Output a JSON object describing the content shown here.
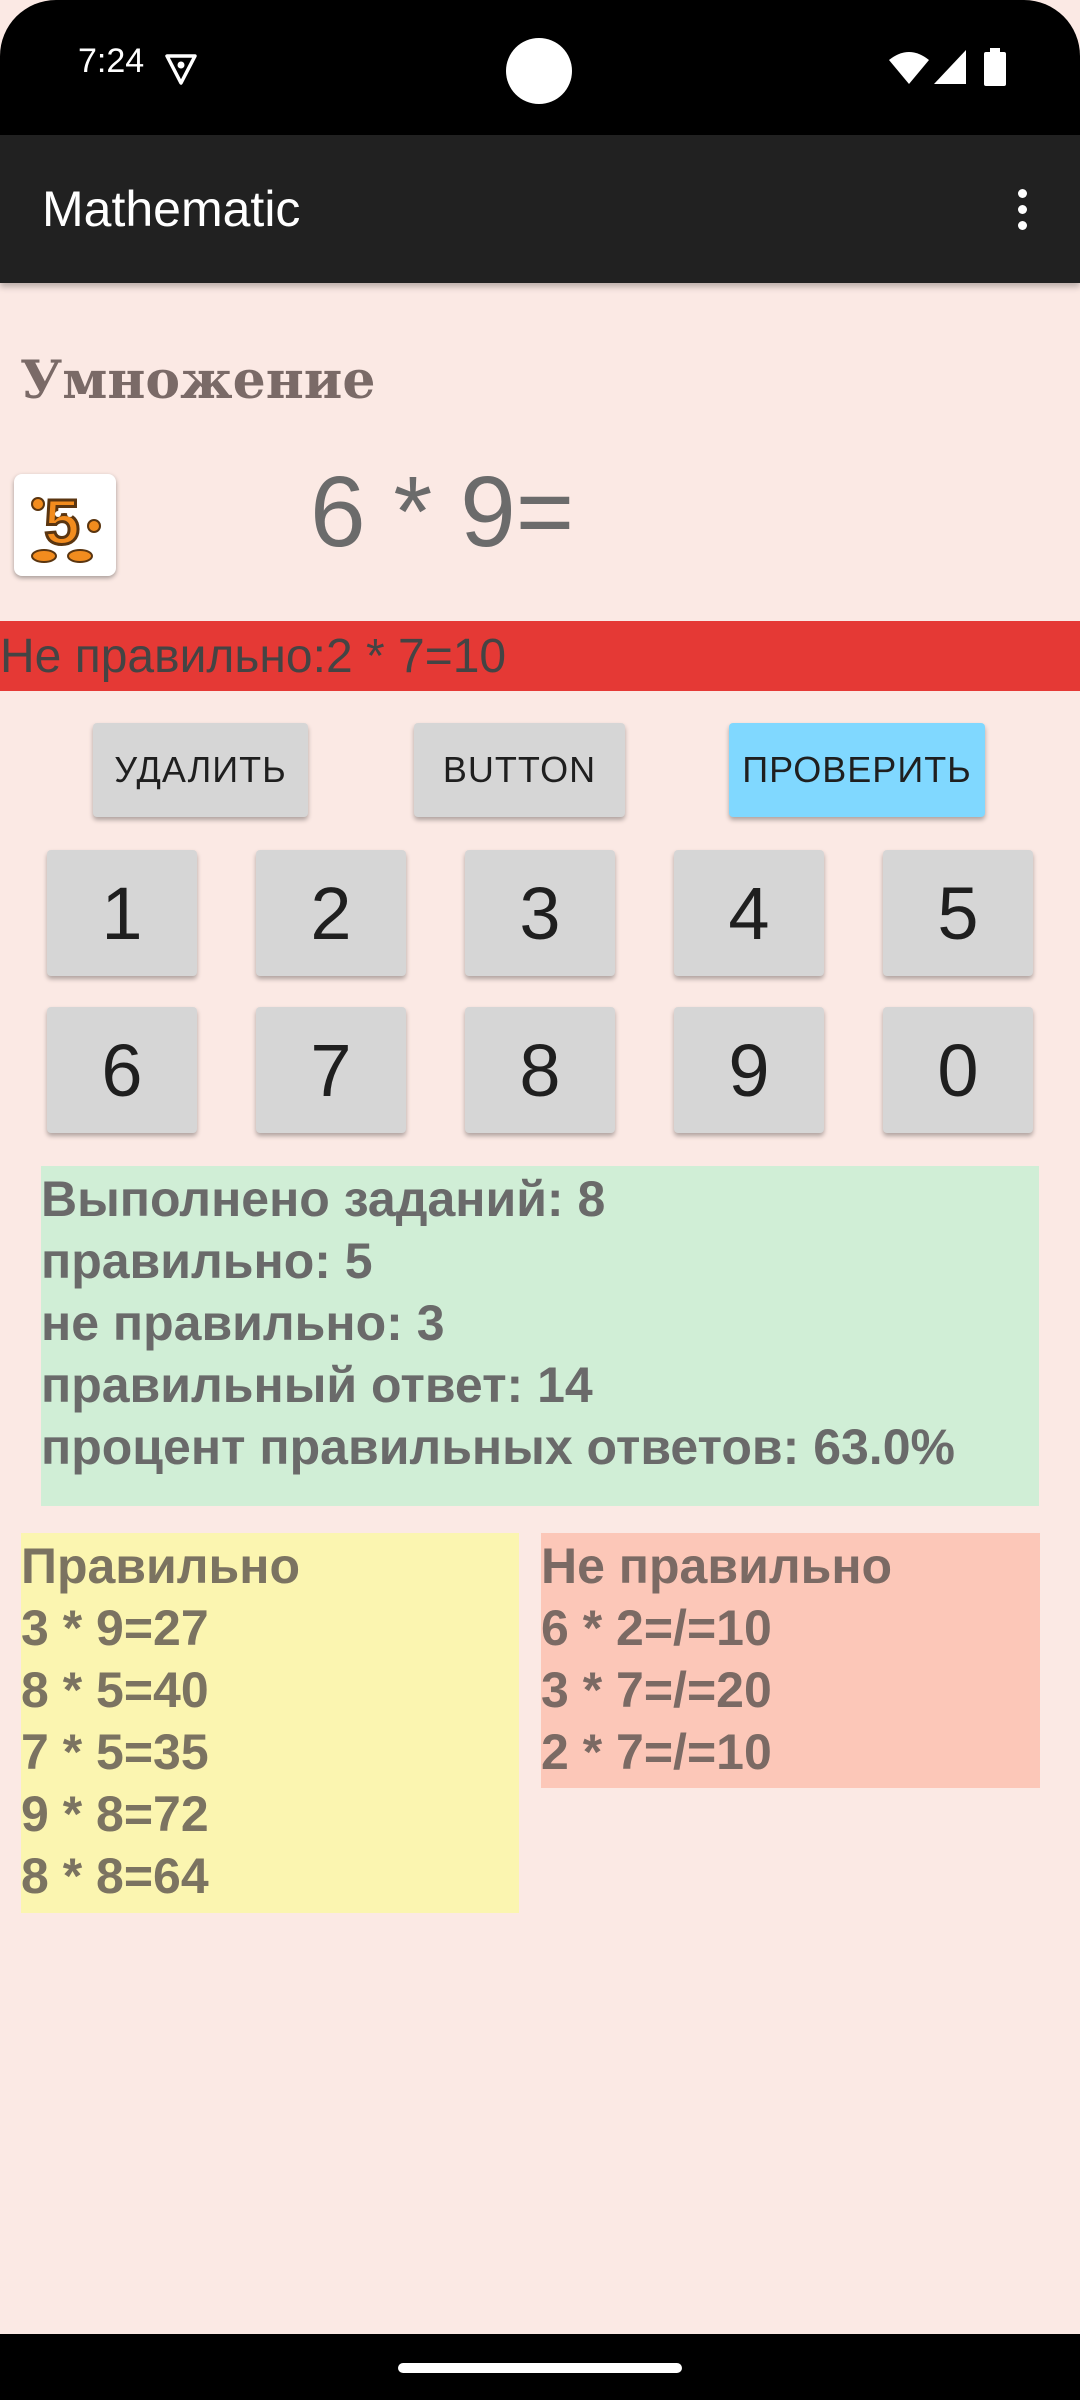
{
  "status_bar": {
    "time": "7:24",
    "icons": [
      "vpn-icon",
      "wifi-icon",
      "signal-icon",
      "battery-icon"
    ]
  },
  "app_bar": {
    "title": "Mathematic",
    "menu_icon": "overflow-menu-icon"
  },
  "task": {
    "operation": "Умножение",
    "expression": "6 * 9="
  },
  "result": {
    "text": "Не правильно:2 * 7=10",
    "color": "#e53935"
  },
  "actions": {
    "delete_label": "УДАЛИТЬ",
    "extra_label": "BUTTON",
    "check_label": "ПРОВЕРИТЬ",
    "check_color": "#80d8ff"
  },
  "keypad": {
    "keys": [
      "1",
      "2",
      "3",
      "4",
      "5",
      "6",
      "7",
      "8",
      "9",
      "0"
    ]
  },
  "stats": {
    "lines": [
      "Выполнено заданий: 8",
      "правильно: 5",
      "не правильно: 3",
      "правильный ответ: 14",
      "процент правильных ответов: 63.0%"
    ],
    "background": "#d0eed6"
  },
  "correct": {
    "title": "Правильно",
    "items": [
      "3 * 9=27",
      "8 * 5=40",
      "7 * 5=35",
      "9 * 8=72",
      "8 * 8=64"
    ],
    "background": "#fbf5b0"
  },
  "wrong": {
    "title": "Не правильно",
    "items": [
      "6 * 2=/=10",
      "3 * 7=/=20",
      "2 * 7=/=10"
    ],
    "background": "#fcc7b8"
  }
}
